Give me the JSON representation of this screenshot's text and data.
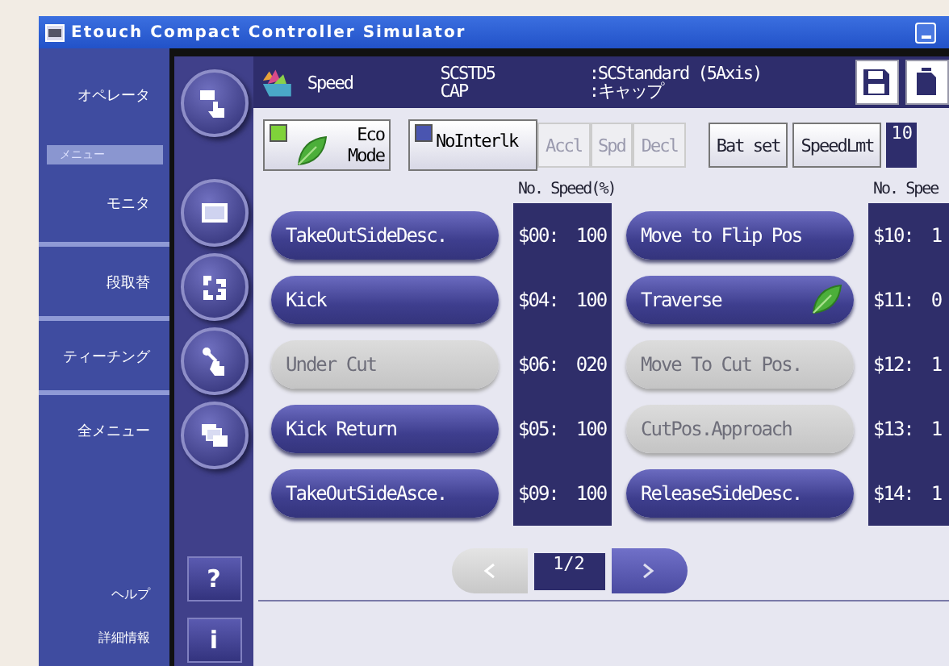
{
  "window": {
    "title": "Etouch Compact Controller Simulator"
  },
  "sidebar": {
    "items": [
      {
        "kind": "item",
        "label": "オペレータ"
      },
      {
        "kind": "header",
        "label": "メニュー"
      },
      {
        "kind": "item",
        "label": "モニタ"
      },
      {
        "kind": "item",
        "label": "段取替"
      },
      {
        "kind": "item",
        "label": "ティーチング"
      },
      {
        "kind": "item",
        "label": "全メニュー"
      }
    ],
    "bottom_items": [
      "ヘルプ",
      "詳細情報"
    ]
  },
  "icon_bar": {
    "help_buttons": [
      "?",
      "i"
    ]
  },
  "header": {
    "title": "Speed",
    "program": "SCSTD5",
    "program_sub": "CAP",
    "description": ":SCStandard (5Axis)",
    "description_sub": ":キャップ"
  },
  "toolbar": [
    {
      "kind": "toggle",
      "lines": [
        "Eco",
        "Mode"
      ],
      "on": true,
      "leaf": true
    },
    {
      "kind": "toggle",
      "lines": [
        "NoInterlk"
      ],
      "on": false,
      "leaf": false
    },
    {
      "kind": "button",
      "label": "Accl",
      "disabled": true
    },
    {
      "kind": "button",
      "label": "Spd",
      "disabled": true
    },
    {
      "kind": "button",
      "label": "Decl",
      "disabled": true
    },
    {
      "kind": "gap"
    },
    {
      "kind": "button",
      "label": "Bat set",
      "disabled": false
    },
    {
      "kind": "button",
      "label": "SpeedLmt",
      "disabled": false
    },
    {
      "kind": "display",
      "label": "10"
    }
  ],
  "columns": [
    {
      "heading": "No. Speed(%)",
      "steps": [
        {
          "label": "TakeOutSideDesc.",
          "disabled": false,
          "eco": false,
          "number": "$00:",
          "speed": "100"
        },
        {
          "label": "Kick",
          "disabled": false,
          "eco": false,
          "number": "$04:",
          "speed": "100"
        },
        {
          "label": "Under Cut",
          "disabled": true,
          "eco": false,
          "number": "$06:",
          "speed": "020"
        },
        {
          "label": "Kick Return",
          "disabled": false,
          "eco": false,
          "number": "$05:",
          "speed": "100"
        },
        {
          "label": "TakeOutSideAsce.",
          "disabled": false,
          "eco": false,
          "number": "$09:",
          "speed": "100"
        }
      ]
    },
    {
      "heading": "No. Spee",
      "steps": [
        {
          "label": "Move to Flip Pos",
          "disabled": false,
          "eco": false,
          "number": "$10:",
          "speed": "1"
        },
        {
          "label": "Traverse",
          "disabled": false,
          "eco": true,
          "number": "$11:",
          "speed": "0"
        },
        {
          "label": "Move To Cut Pos.",
          "disabled": true,
          "eco": false,
          "number": "$12:",
          "speed": "1"
        },
        {
          "label": "CutPos.Approach",
          "disabled": true,
          "eco": false,
          "number": "$13:",
          "speed": "1"
        },
        {
          "label": "ReleaseSideDesc.",
          "disabled": false,
          "eco": false,
          "number": "$14:",
          "speed": "1"
        }
      ]
    }
  ],
  "pager": {
    "prev_disabled": true,
    "next_disabled": false,
    "page": "1/2"
  }
}
